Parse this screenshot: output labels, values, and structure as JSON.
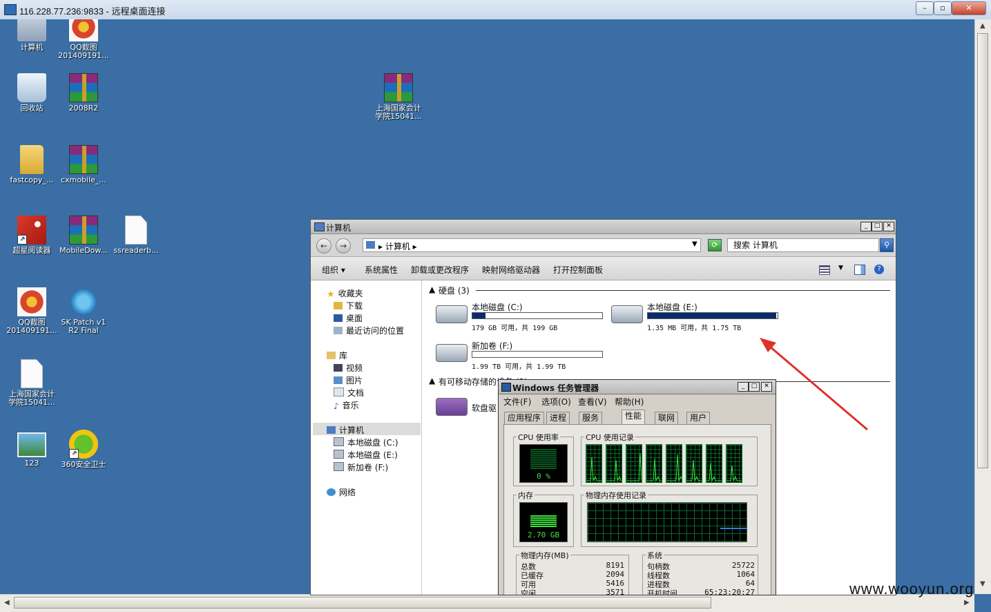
{
  "rdp": {
    "title": "116.228.77.236:9833 - 远程桌面连接",
    "minimize": "–",
    "restore": "▫",
    "close": "✕"
  },
  "desktop": {
    "icons": [
      {
        "label": "计算机",
        "icon": "computer-icon"
      },
      {
        "label": "QQ截图\n201409191...",
        "icon": "image-icon"
      },
      {
        "label": "回收站",
        "icon": "recycle-bin-icon"
      },
      {
        "label": "2008R2",
        "icon": "rar-archive-icon"
      },
      {
        "label": "上海国家会计\n学院15041...",
        "icon": "rar-archive-icon"
      },
      {
        "label": "fastcopy_...",
        "icon": "folder-icon"
      },
      {
        "label": "cxmobile_...",
        "icon": "rar-archive-icon"
      },
      {
        "label": "超星阅读器",
        "icon": "chaoxing-reader-icon"
      },
      {
        "label": "MobileDow...",
        "icon": "rar-archive-icon"
      },
      {
        "label": "ssreaderb...",
        "icon": "file-icon"
      },
      {
        "label": "QQ截图\n201409191...",
        "icon": "image-icon"
      },
      {
        "label": "SK Patch v1\nR2 Final",
        "icon": "sk-patch-icon"
      },
      {
        "label": "上海国家会计\n学院15041...",
        "icon": "file-icon"
      },
      {
        "label": "123",
        "icon": "picture-icon"
      },
      {
        "label": "360安全卫士",
        "icon": "360-security-icon"
      }
    ]
  },
  "explorer": {
    "title": "计算机",
    "address": "▸ 计算机 ▸",
    "search_placeholder": "搜索 计算机",
    "commands": [
      "组织 ▾",
      "系统属性",
      "卸载或更改程序",
      "映射网络驱动器",
      "打开控制面板"
    ],
    "nav": {
      "favorites": "收藏夹",
      "downloads": "下载",
      "desktop": "桌面",
      "recent": "最近访问的位置",
      "libraries": "库",
      "videos": "视频",
      "pictures": "图片",
      "documents": "文档",
      "music": "音乐",
      "computer": "计算机",
      "drive_c": "本地磁盘 (C:)",
      "drive_e": "本地磁盘 (E:)",
      "drive_f": "新加卷 (F:)",
      "network": "网络"
    },
    "group_hdd": "硬盘 (3)",
    "group_removable": "有可移动存储的设备 (2)",
    "drives": [
      {
        "name": "本地磁盘 (C:)",
        "info": "179 GB 可用，共 199 GB",
        "used_fraction": 0.1
      },
      {
        "name": "本地磁盘 (E:)",
        "info": "1.35 MB 可用，共 1.75 TB",
        "used_fraction": 0.99
      },
      {
        "name": "新加卷 (F:)",
        "info": "1.99 TB 可用，共 1.99 TB",
        "used_fraction": 0.0
      }
    ],
    "floppy": "软盘驱"
  },
  "taskmgr": {
    "title": "Windows 任务管理器",
    "menu": [
      "文件(F)",
      "选项(O)",
      "查看(V)",
      "帮助(H)"
    ],
    "tabs": [
      "应用程序",
      "进程",
      "服务",
      "性能",
      "联网",
      "用户"
    ],
    "cpu_usage_label": "CPU 使用率",
    "cpu_history_label": "CPU 使用记录",
    "cpu_value": "0 %",
    "mem_label": "内存",
    "mem_history_label": "物理内存使用记录",
    "mem_value": "2.70 GB",
    "phys_mem_label": "物理内存(MB)",
    "phys_mem": [
      {
        "k": "总数",
        "v": "8191"
      },
      {
        "k": "已缓存",
        "v": "2094"
      },
      {
        "k": "可用",
        "v": "5416"
      },
      {
        "k": "空闲",
        "v": "3571"
      }
    ],
    "system_label": "系统",
    "system": [
      {
        "k": "句柄数",
        "v": "25722"
      },
      {
        "k": "线程数",
        "v": "1064"
      },
      {
        "k": "进程数",
        "v": "64"
      },
      {
        "k": "开机时间",
        "v": "65:23:20:27"
      }
    ]
  },
  "watermark": "www.wooyun.org",
  "colors": {
    "desktop": "#3a6ea5",
    "drive_bar": "#0b2a6e",
    "graph": "#3ee43e",
    "arrow": "#e0302a"
  }
}
